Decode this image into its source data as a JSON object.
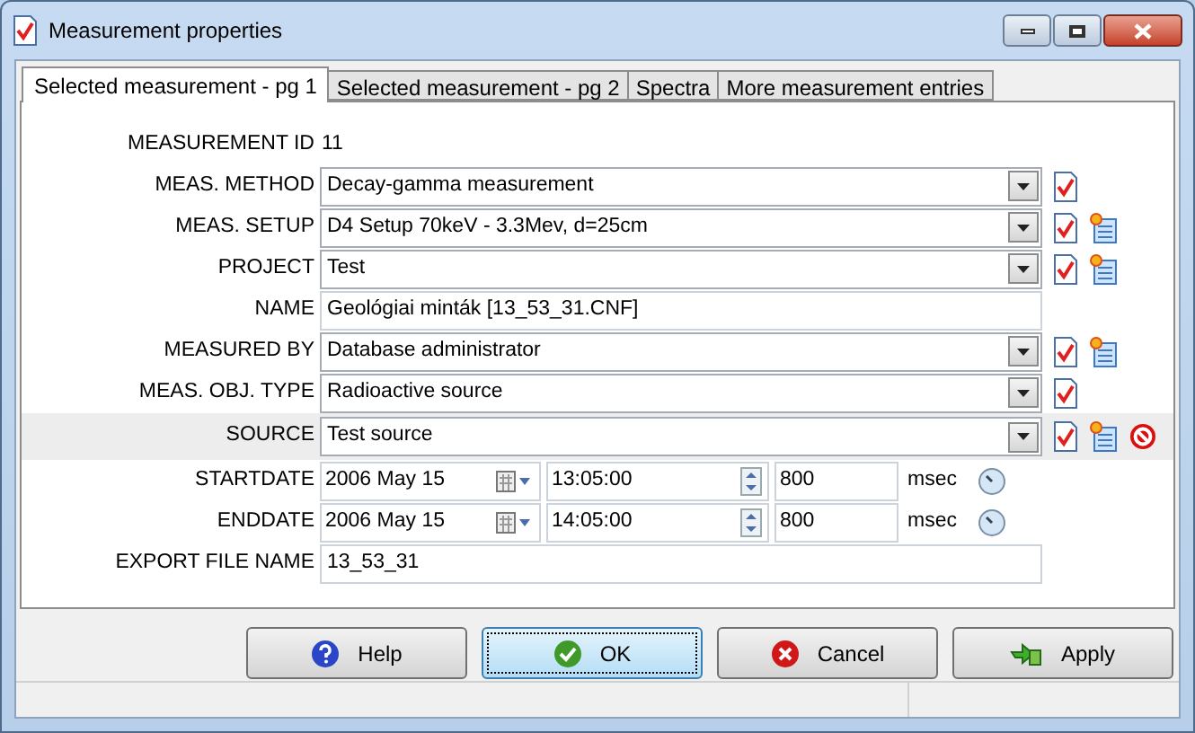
{
  "window": {
    "title": "Measurement properties"
  },
  "tabs": [
    {
      "label": "Selected measurement - pg 1",
      "selected": true
    },
    {
      "label": "Selected measurement - pg 2",
      "selected": false
    },
    {
      "label": "Spectra",
      "selected": false
    },
    {
      "label": "More measurement entries",
      "selected": false
    }
  ],
  "rows": [
    {
      "kind": "text",
      "label": "MEASUREMENT ID",
      "value": "11",
      "selected": false,
      "actions": []
    },
    {
      "kind": "combo",
      "label": "MEAS. METHOD",
      "value": "Decay-gamma measurement",
      "selected": false,
      "actions": [
        {
          "kind": "edit"
        }
      ]
    },
    {
      "kind": "combo",
      "label": "MEAS. SETUP",
      "value": "D4 Setup 70keV - 3.3Mev, d=25cm",
      "selected": false,
      "actions": [
        {
          "kind": "edit"
        },
        {
          "kind": "new"
        }
      ]
    },
    {
      "kind": "combo",
      "label": "PROJECT",
      "value": "Test",
      "selected": false,
      "actions": [
        {
          "kind": "edit"
        },
        {
          "kind": "new"
        }
      ]
    },
    {
      "kind": "field",
      "label": "NAME",
      "value": "Geológiai minták [13_53_31.CNF]",
      "selected": false,
      "actions": []
    },
    {
      "kind": "combo",
      "label": "MEASURED BY",
      "value": "Database administrator",
      "selected": false,
      "actions": [
        {
          "kind": "edit"
        },
        {
          "kind": "new"
        }
      ]
    },
    {
      "kind": "combo",
      "label": "MEAS. OBJ. TYPE",
      "value": "Radioactive source",
      "selected": false,
      "actions": [
        {
          "kind": "edit"
        }
      ]
    },
    {
      "kind": "combo",
      "label": "SOURCE",
      "value": "Test source",
      "selected": true,
      "actions": [
        {
          "kind": "edit"
        },
        {
          "kind": "new"
        },
        {
          "kind": "clear"
        }
      ]
    },
    {
      "kind": "datetime",
      "label": "STARTDATE",
      "date": "2006 May 15",
      "time": "13:05:00",
      "ms": "800",
      "unit": "msec",
      "selected": false,
      "actions": []
    },
    {
      "kind": "datetime",
      "label": "ENDDATE",
      "date": "2006 May 15",
      "time": "14:05:00",
      "ms": "800",
      "unit": "msec",
      "selected": false,
      "actions": []
    },
    {
      "kind": "field",
      "label": "EXPORT FILE NAME",
      "value": "13_53_31",
      "selected": false,
      "actions": []
    }
  ],
  "buttons": [
    {
      "kind": "help",
      "label": "Help",
      "default": false
    },
    {
      "kind": "ok",
      "label": "OK",
      "default": true
    },
    {
      "kind": "cancel",
      "label": "Cancel",
      "default": false
    },
    {
      "kind": "apply",
      "label": "Apply",
      "default": false
    }
  ]
}
